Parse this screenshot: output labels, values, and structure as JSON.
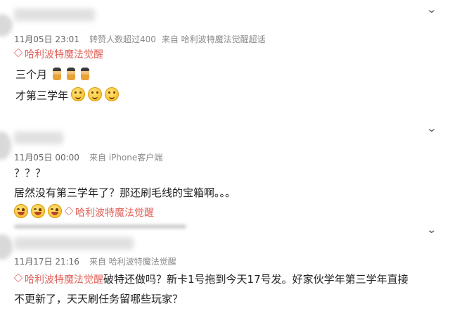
{
  "post1": {
    "time": "11月05日 23:01",
    "reposts": "转赞人数超过400",
    "source": "来自 哈利波特魔法觉醒超话",
    "topic": "哈利波特魔法觉醒",
    "line1": "三个月",
    "line2": "才第三学年"
  },
  "post2": {
    "time": "11月05日 00:00",
    "source": "来自 iPhone客户端",
    "line1": "？？？",
    "line2": "居然没有第三学年了？那还刷毛线的宝箱啊。。。",
    "topic": "哈利波特魔法觉醒"
  },
  "post3": {
    "time": "11月17日 21:16",
    "source": "来自 哈利波特魔法觉醒",
    "topic": "哈利波特魔法觉醒",
    "line1": "破特还做吗？新卡1号拖到今天17号发。好家伙学年第三学年直接",
    "line2": "不更新了，天天刷任务留哪些玩家？"
  },
  "icons": [
    "chevron-down-icon",
    "topic-diamond-icon",
    "doll-emoji-icon",
    "smile-emoji-icon",
    "laugh-emoji-icon"
  ]
}
